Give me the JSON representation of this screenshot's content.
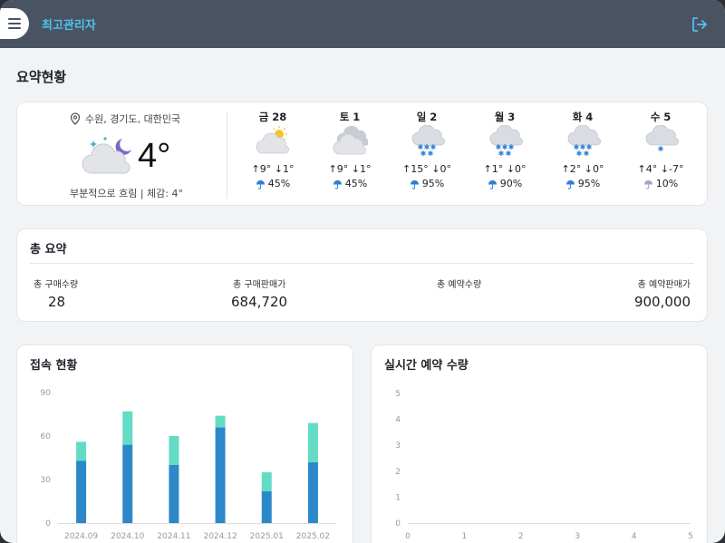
{
  "header": {
    "title": "최고관리자",
    "menu_icon": "hamburger-icon",
    "logout_icon": "logout-icon"
  },
  "page": {
    "title": "요약현황"
  },
  "weather": {
    "location": "수원, 경기도, 대한민국",
    "current_temp": "4°",
    "current_desc": "부분적으로 흐림 | 체감: 4°",
    "current_icon": "partly-cloudy-night-icon",
    "forecast": [
      {
        "day": "금 28",
        "icon": "partly-sunny-icon",
        "temp": "↑9° ↓1°",
        "rain": "45%"
      },
      {
        "day": "토 1",
        "icon": "cloudy-icon",
        "temp": "↑9° ↓1°",
        "rain": "45%"
      },
      {
        "day": "일 2",
        "icon": "snow-icon",
        "temp": "↑15° ↓0°",
        "rain": "95%"
      },
      {
        "day": "월 3",
        "icon": "snow-icon",
        "temp": "↑1° ↓0°",
        "rain": "90%"
      },
      {
        "day": "화 4",
        "icon": "snow-icon",
        "temp": "↑2° ↓0°",
        "rain": "95%"
      },
      {
        "day": "수 5",
        "icon": "light-snow-icon",
        "temp": "↑4° ↓-7°",
        "rain": "10%"
      }
    ]
  },
  "summary": {
    "title": "총 요약",
    "stats": [
      {
        "label": "총 구매수량",
        "value": "28"
      },
      {
        "label": "총 구매판매가",
        "value": "684,720"
      },
      {
        "label": "총 예약수량",
        "value": ""
      },
      {
        "label": "총 예약판매가",
        "value": "900,000"
      }
    ]
  },
  "access_chart": {
    "title": "접속 현황"
  },
  "live_chart": {
    "title": "실시간 예약 수량"
  },
  "chart_data": [
    {
      "type": "bar",
      "title": "접속 현황",
      "categories": [
        "2024.09",
        "2024.10",
        "2024.11",
        "2024.12",
        "2025.01",
        "2025.02"
      ],
      "series": [
        {
          "values": [
            43,
            54,
            40,
            66,
            22,
            42
          ],
          "color": "#2c88c8"
        },
        {
          "values": [
            13,
            23,
            20,
            8,
            13,
            27
          ],
          "color": "#62dcc4"
        }
      ],
      "stacked": true,
      "ylim": [
        0,
        90
      ],
      "yticks": [
        0,
        30,
        60,
        90
      ],
      "grid": false
    },
    {
      "type": "line",
      "title": "실시간 예약 수량",
      "x": [
        0,
        1,
        2,
        3,
        4,
        5
      ],
      "xlim": [
        0,
        5
      ],
      "ylim": [
        0,
        5
      ],
      "yticks": [
        0,
        1,
        2,
        3,
        4,
        5
      ],
      "series": []
    }
  ]
}
